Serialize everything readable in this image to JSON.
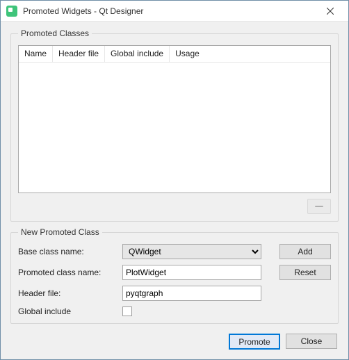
{
  "window": {
    "title": "Promoted Widgets - Qt Designer"
  },
  "group_promoted": {
    "legend": "Promoted Classes",
    "columns": {
      "name": "Name",
      "header": "Header file",
      "global": "Global include",
      "usage": "Usage"
    }
  },
  "group_new": {
    "legend": "New Promoted Class",
    "base_label": "Base class name:",
    "base_value": "QWidget",
    "promoted_label": "Promoted class name:",
    "promoted_value": "PlotWidget",
    "header_label": "Header file:",
    "header_value": "pyqtgraph",
    "global_label": "Global include",
    "add_label": "Add",
    "reset_label": "Reset"
  },
  "footer": {
    "promote": "Promote",
    "close": "Close"
  }
}
